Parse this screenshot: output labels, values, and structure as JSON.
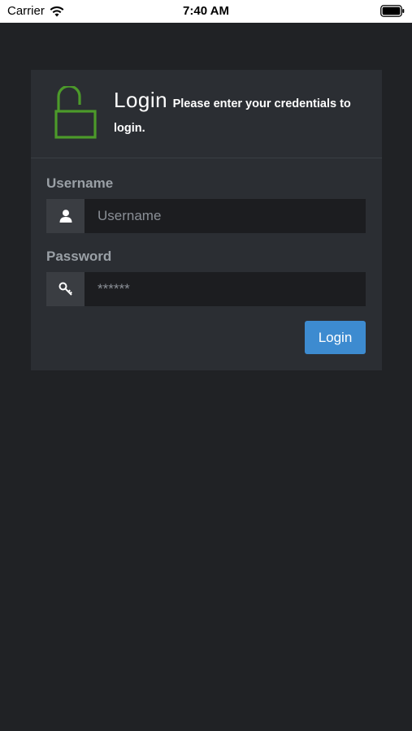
{
  "status_bar": {
    "carrier": "Carrier",
    "time": "7:40 AM"
  },
  "header": {
    "title": "Login",
    "subtitle": "Please enter your credentials to login.",
    "lock_icon": "unlocked-padlock-icon",
    "lock_color": "#4c9a2a"
  },
  "form": {
    "username": {
      "label": "Username",
      "placeholder": "Username",
      "icon": "user-icon"
    },
    "password": {
      "label": "Password",
      "placeholder": "******",
      "icon": "key-icon"
    },
    "submit_label": "Login"
  },
  "colors": {
    "background": "#202225",
    "panel": "#2b2e33",
    "button": "#3d8bd0",
    "input": "#1c1d20"
  }
}
